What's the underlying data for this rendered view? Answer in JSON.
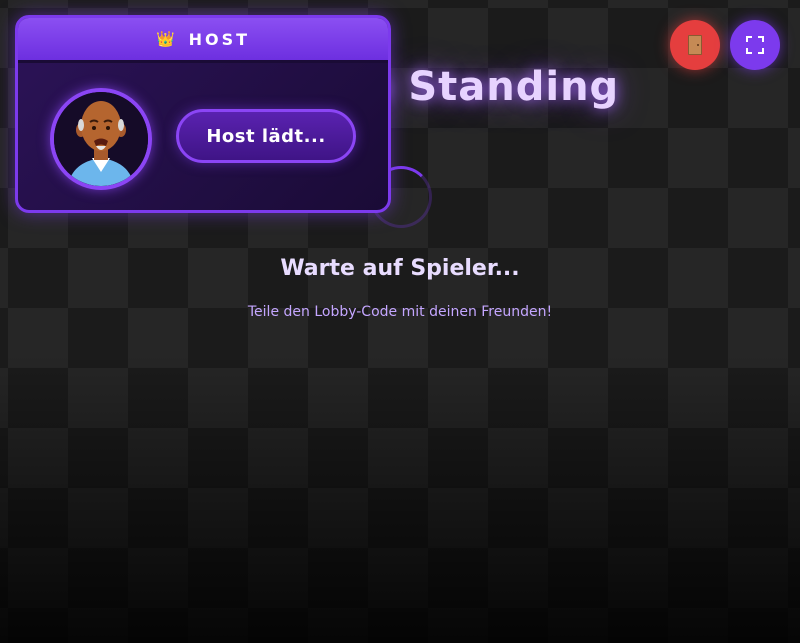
{
  "game": {
    "title": "Last Man Standing",
    "waiting_title": "Warte auf Spieler...",
    "waiting_hint": "Teile den Lobby-Code mit deinen Freunden!"
  },
  "host_card": {
    "crown_icon": "crown-icon",
    "label": "HOST",
    "avatar_icon": "bald-man-avatar",
    "status_button": "Host lädt..."
  },
  "controls": {
    "exit_icon": "door-icon",
    "fullscreen_icon": "fullscreen-icon"
  },
  "colors": {
    "accent": "#7c3aed",
    "danger": "#e53e3e",
    "title": "#e7d3ff"
  }
}
